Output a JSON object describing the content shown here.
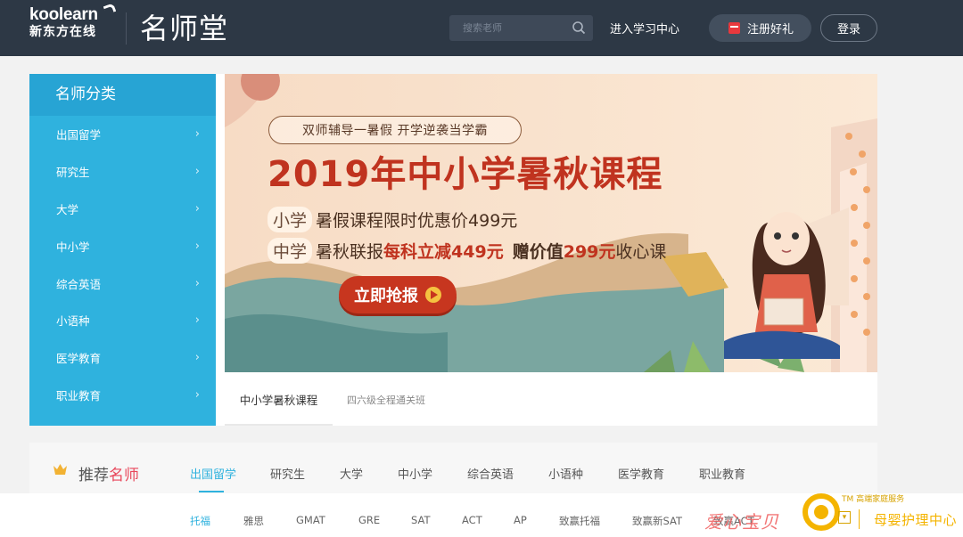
{
  "header": {
    "logo_en": "koolearn",
    "logo_cn": "新东方在线",
    "brand_title": "名师堂",
    "search_placeholder": "搜索老师",
    "study_center_link": "进入学习中心",
    "register_label": "注册好礼",
    "login_label": "登录"
  },
  "sidebar": {
    "title": "名师分类",
    "items": [
      {
        "label": "出国留学"
      },
      {
        "label": "研究生"
      },
      {
        "label": "大学"
      },
      {
        "label": "中小学"
      },
      {
        "label": "综合英语"
      },
      {
        "label": "小语种"
      },
      {
        "label": "医学教育"
      },
      {
        "label": "职业教育"
      }
    ]
  },
  "banner": {
    "pill_text": "双师辅导一暑假  开学逆袭当学霸",
    "title": "2019年中小学暑秋课程",
    "line1_tag": "小学",
    "line1_text": "暑假课程限时优惠价499元",
    "line2_tag": "中学",
    "line2_text_a": "暑秋联报",
    "line2_text_b": "每科立减449元",
    "line2_text_c": "赠价值",
    "line2_text_d": "299元",
    "line2_text_e": "收心课",
    "cta_label": "立即抢报"
  },
  "banner_tabs": [
    {
      "label": "中小学暑秋课程",
      "active": true
    },
    {
      "label": "四六级全程通关班",
      "active": false
    }
  ],
  "teachers": {
    "title_a": "推荐",
    "title_b": "名师",
    "subject_tabs": [
      {
        "label": "出国留学",
        "active": true
      },
      {
        "label": "研究生"
      },
      {
        "label": "大学"
      },
      {
        "label": "中小学"
      },
      {
        "label": "综合英语"
      },
      {
        "label": "小语种"
      },
      {
        "label": "医学教育"
      },
      {
        "label": "职业教育"
      }
    ],
    "exam_tabs": [
      {
        "label": "托福",
        "active": true
      },
      {
        "label": "雅思"
      },
      {
        "label": "GMAT"
      },
      {
        "label": "GRE"
      },
      {
        "label": "SAT"
      },
      {
        "label": "ACT"
      },
      {
        "label": "AP"
      },
      {
        "label": "致赢托福"
      },
      {
        "label": "致赢新SAT"
      },
      {
        "label": "致赢ACT"
      }
    ]
  },
  "watermark": {
    "text1": "爱心宝贝",
    "tm": "TM 高端家庭服务",
    "text2": "母婴护理中心"
  },
  "colors": {
    "header_bg": "#2d3845",
    "accent_blue": "#2fb2de",
    "banner_red": "#c0331f"
  }
}
